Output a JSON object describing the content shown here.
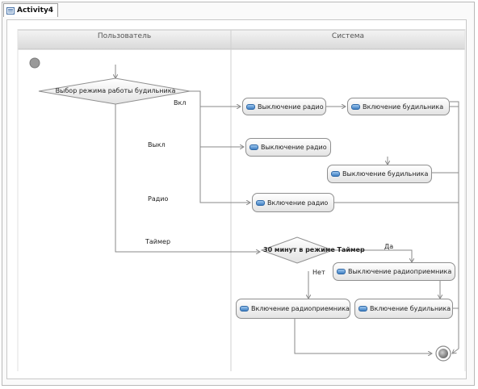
{
  "editor": {
    "tab_label": "Activity4",
    "tab_icon": "activity-diagram-icon"
  },
  "lanes": {
    "left_title": "Пользователь",
    "right_title": "Система"
  },
  "decisions": {
    "mode": "Выбор режима работы будильника",
    "timer": "30 минут в режиме Таймер"
  },
  "guards": {
    "on": "Вкл",
    "off": "Выкл",
    "radio": "Радио",
    "timer": "Таймер",
    "yes": "Да",
    "no": "Нет"
  },
  "actions": {
    "radio_off_1": "Выключение радио",
    "alarm_on_1": "Включение будильника",
    "radio_off_2": "Выключение радио",
    "alarm_off": "Выключение будильника",
    "radio_on": "Включение радио",
    "radio_receiver_off": "Выключение радиоприемника",
    "radio_receiver_on": "Включение радиоприемника",
    "alarm_on_2": "Включение будильника"
  },
  "colors": {
    "action_icon": "#3f7fc2",
    "lane_header": "#e4e4e4",
    "flow": "#8a8a8a"
  }
}
